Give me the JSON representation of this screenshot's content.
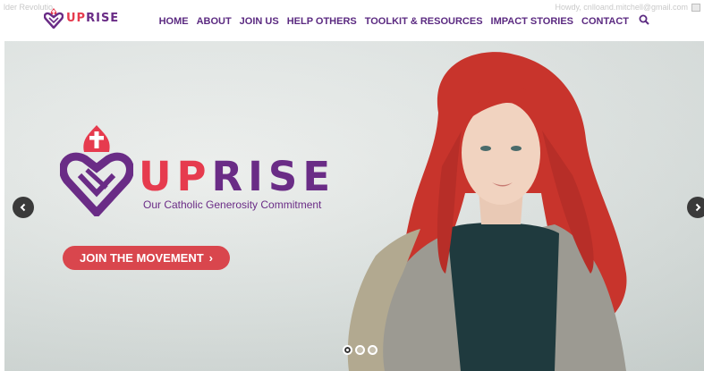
{
  "admin_bar": {
    "left_text": "lder Revolutio",
    "right_text": "Howdy, cnlloand.mitchell@gmail.com"
  },
  "brand": {
    "name": "UPRISE",
    "name_part_red": "UP",
    "name_part_purple": "RISE"
  },
  "nav": {
    "items": [
      "HOME",
      "ABOUT",
      "JOIN US",
      "HELP OTHERS",
      "TOOLKIT & RESOURCES",
      "IMPACT STORIES",
      "CONTACT"
    ],
    "search_icon": "search-icon"
  },
  "hero": {
    "logo_red": "UP",
    "logo_purple": "RISE",
    "tagline": "Our Catholic Generosity Commitment",
    "cta_label": "JOIN THE MOVEMENT",
    "cta_arrow": "›",
    "slides_total": 3,
    "active_slide": 1
  },
  "colors": {
    "purple": "#5b2a81",
    "red": "#e63b4e",
    "cta": "#d9464d"
  }
}
